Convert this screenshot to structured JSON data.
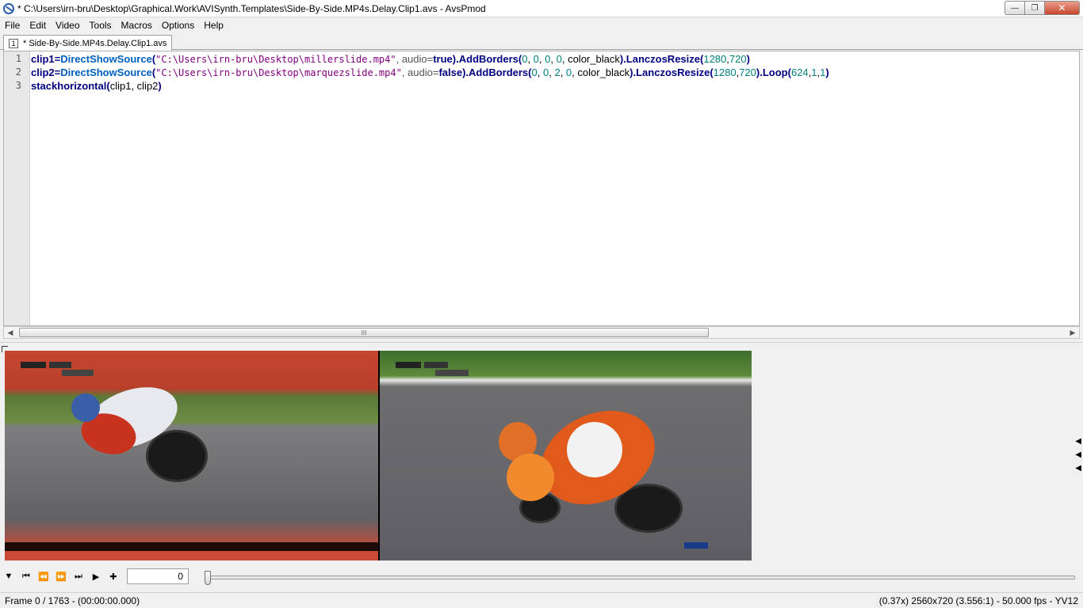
{
  "window": {
    "title": "* C:\\Users\\irn-bru\\Desktop\\Graphical.Work\\AVISynth.Templates\\Side-By-Side.MP4s.Delay.Clip1.avs - AvsPmod"
  },
  "menu": {
    "items": [
      {
        "label": "File"
      },
      {
        "label": "Edit"
      },
      {
        "label": "Video"
      },
      {
        "label": "Tools"
      },
      {
        "label": "Macros"
      },
      {
        "label": "Options"
      },
      {
        "label": "Help"
      }
    ]
  },
  "tabs": [
    {
      "number": "1",
      "label": "* Side-By-Side.MP4s.Delay.Clip1.avs"
    }
  ],
  "editor": {
    "line_numbers": [
      "1",
      "2",
      "3"
    ],
    "lines": [
      {
        "var": "clip1",
        "eq": "=",
        "fn1": "DirectShowSource",
        "open1": "(",
        "path": "\"C:\\Users\\irn-bru\\Desktop\\millerslide.mp4\"",
        "audio_param": ", audio=",
        "audio_val": "true",
        "close1": ").",
        "fn2": "AddBorders",
        "open2": "(",
        "b1": "0",
        "b2": "0",
        "b3": "0",
        "b4": "0",
        "color": "color_black",
        "close2": ").",
        "fn3": "LanczosResize",
        "open3": "(",
        "w": "1280",
        "h": "720",
        "close3": ")"
      },
      {
        "var": "clip2",
        "eq": "=",
        "fn1": "DirectShowSource",
        "open1": "(",
        "path": "\"C:\\Users\\irn-bru\\Desktop\\marquezslide.mp4\"",
        "audio_param": ", audio=",
        "audio_val": "false",
        "close1": ").",
        "fn2": "AddBorders",
        "open2": "(",
        "b1": "0",
        "b2": "0",
        "b3": "2",
        "b4": "0",
        "color": "color_black",
        "close2": ").",
        "fn3": "LanczosResize",
        "open3": "(",
        "w": "1280",
        "h": "720",
        "close3": ").",
        "fn4": "Loop",
        "open4": "(",
        "l1": "624",
        "l2": "1",
        "l3": "1",
        "close4": ")"
      },
      {
        "fn": "stackhorizontal",
        "open": "(",
        "args": "clip1, clip2",
        "close": ")"
      }
    ]
  },
  "scrollbar": {
    "grip": "III"
  },
  "playback": {
    "frame_value": "0"
  },
  "status": {
    "left": "Frame 0 / 1763  -  (00:00:00.000)",
    "right": "(0.37x)  2560x720 (3.556:1)  -  50.000 fps  -  YV12"
  },
  "colors": {
    "keyword": "#000080",
    "function": "#0060c0",
    "string": "#800080",
    "number": "#008080"
  }
}
